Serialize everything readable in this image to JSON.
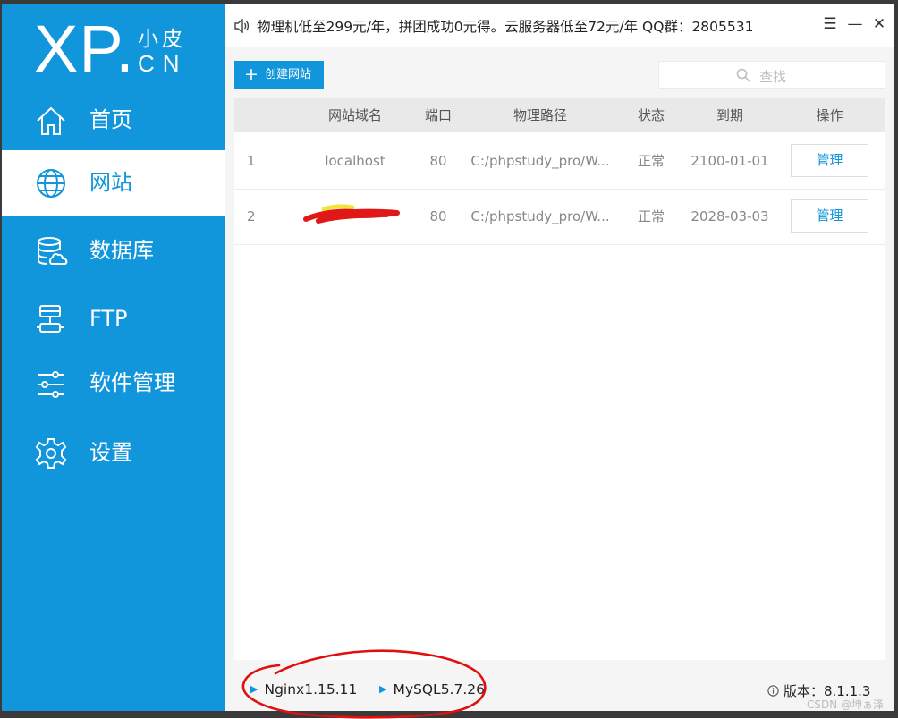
{
  "logo": {
    "xp": "XP.",
    "cn_top": "小皮",
    "cn_bottom": "CN"
  },
  "nav": [
    {
      "label": "首页",
      "icon": "home-icon"
    },
    {
      "label": "网站",
      "icon": "globe-icon",
      "active": true
    },
    {
      "label": "数据库",
      "icon": "database-icon"
    },
    {
      "label": "FTP",
      "icon": "ftp-icon"
    },
    {
      "label": "软件管理",
      "icon": "sliders-icon"
    },
    {
      "label": "设置",
      "icon": "gear-icon"
    }
  ],
  "titlebar": {
    "notice": "物理机低至299元/年，拼团成功0元得。云服务器低至72元/年  QQ群：2805531",
    "menu": "☰",
    "minimize": "—",
    "close": "✕"
  },
  "toolbar": {
    "create_label": "创建网站",
    "create_icon": "+",
    "search_placeholder": "查找"
  },
  "table": {
    "headers": [
      "网站域名",
      "端口",
      "物理路径",
      "状态",
      "到期",
      "操作"
    ],
    "rows": [
      {
        "index": "1",
        "domain": "localhost",
        "port": "80",
        "path": "C:/phpstudy_pro/W...",
        "status": "正常",
        "expire": "2100-01-01",
        "action": "管理"
      },
      {
        "index": "2",
        "domain": "",
        "domain_redacted": true,
        "port": "80",
        "path": "C:/phpstudy_pro/W...",
        "status": "正常",
        "expire": "2028-03-03",
        "action": "管理"
      }
    ]
  },
  "footer": {
    "services": [
      "Nginx1.15.11",
      "MySQL5.7.26"
    ],
    "version": "版本：8.1.1.3",
    "watermark": "CSDN @坤ぁ泽"
  },
  "colors": {
    "accent": "#1296db",
    "annotation": "#e01010"
  }
}
